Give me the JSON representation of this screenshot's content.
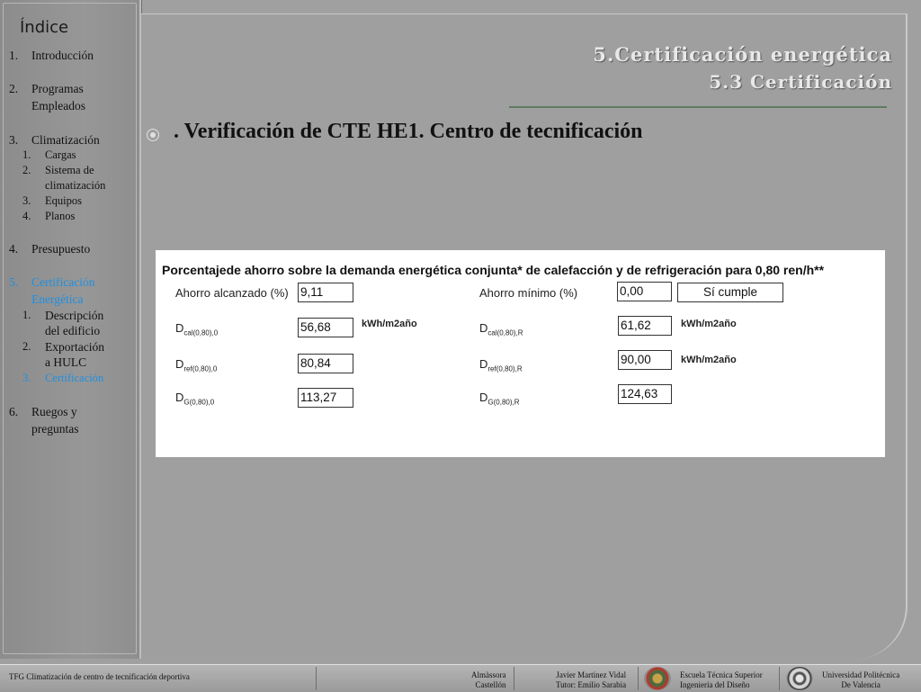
{
  "sidebar": {
    "title": "Índice",
    "items": [
      {
        "num": "1.",
        "label": "Introducción"
      },
      {
        "num": "2.",
        "label": "Programas\nEmpleados"
      },
      {
        "num": "3.",
        "label": "Climatización"
      },
      {
        "num": "4.",
        "label": "Presupuesto"
      },
      {
        "num": "5.",
        "label": "Certificación\nEnergética"
      },
      {
        "num": "6.",
        "label": "Ruegos y\npreguntas"
      }
    ],
    "sub3": [
      {
        "num": "1.",
        "label": "Cargas"
      },
      {
        "num": "2.",
        "label": "Sistema de\nclimatización"
      },
      {
        "num": "3.",
        "label": "Equipos"
      },
      {
        "num": "4.",
        "label": "Planos"
      }
    ],
    "sub5": [
      {
        "num": "1.",
        "label": "Descripción\ndel edificio"
      },
      {
        "num": "2.",
        "label": "Exportación\na HULC"
      },
      {
        "num": "3.",
        "label": "Certificación"
      }
    ],
    "active_color": "#1e90e0"
  },
  "header": {
    "title": "5.Certificación energética",
    "subtitle": "5.3 Certificación"
  },
  "bullet": {
    "icon": "circle-bullet-icon",
    "text": ". Verificación de CTE HE1. Centro de tecnificación"
  },
  "table": {
    "title": "Porcentajede ahorro sobre la demanda energética conjunta* de calefacción y de refrigeración para 0,80 ren/h**",
    "left": {
      "ahorro_label": "Ahorro alcanzado (%)",
      "ahorro_value": "9,11",
      "dcal_main": "D",
      "dcal_sub": "cal(0,80),0",
      "dcal_value": "56,68",
      "dref_main": "D",
      "dref_sub": "ref(0,80),0",
      "dref_value": "80,84",
      "dg_main": "D",
      "dg_sub": "G(0,80),0",
      "dg_value": "113,27",
      "unit": "kWh/m2año"
    },
    "right": {
      "ahorro_label": "Ahorro mínimo (%)",
      "ahorro_value": "0,00",
      "cumple": "Sí cumple",
      "dcal_main": "D",
      "dcal_sub": "cal(0,80),R",
      "dcal_value": "61,62",
      "dref_main": "D",
      "dref_sub": "ref(0,80),R",
      "dref_value": "90,00",
      "dg_main": "D",
      "dg_sub": "G(0,80),R",
      "dg_value": "124,63",
      "unit": "kWh/m2año"
    }
  },
  "footer": {
    "project": "TFG Climatización de centro de tecnificación deportiva",
    "place1": "Almàssora",
    "place2": "Castellón",
    "author": "Javier Martínez Vidal",
    "tutor": "Tutor: Emilio Sarabia",
    "school1": "Escuela Técnica Superior",
    "school2": "Ingeniería del Diseño",
    "uni1": "Universidad Politécnica",
    "uni2": "De Valencia"
  }
}
